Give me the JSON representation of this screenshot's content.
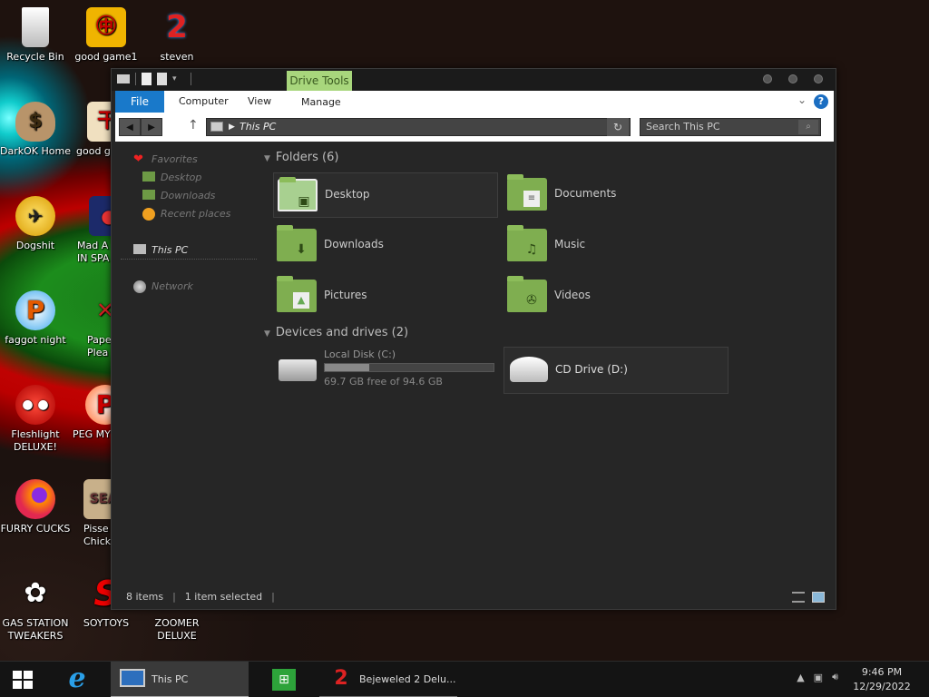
{
  "desktop": {
    "icons": [
      {
        "label": "Recycle Bin",
        "icon": "recycle-bin-icon"
      },
      {
        "label": "good game1",
        "icon": "mahjong-tile-icon"
      },
      {
        "label": "steven",
        "icon": "bejeweled-2-icon"
      },
      {
        "label": "DarkOK Home",
        "icon": "money-bag-icon"
      },
      {
        "label": "good g",
        "icon": "mahjong-tile-icon"
      },
      {
        "label": "Dogshit",
        "icon": "moorhuhn-icon"
      },
      {
        "label": "Mad A\nIN SPA",
        "icon": "angry-birds-space-icon"
      },
      {
        "label": "faggot night",
        "icon": "peggle-icon"
      },
      {
        "label": "Pape\nPlea",
        "icon": "paper-icon"
      },
      {
        "label": "Fleshlight DELUXE!",
        "icon": "red-fuzzy-creature-icon"
      },
      {
        "label": "PEG MY",
        "icon": "peggle-icon"
      },
      {
        "label": "FURRY CUCKS",
        "icon": "firefox-icon"
      },
      {
        "label": "Pisse\nChicke",
        "icon": "chicken-game-icon"
      },
      {
        "label": "GAS STATION TWEAKERS",
        "icon": "flower-pot-icon"
      },
      {
        "label": "SOYTOYS",
        "icon": "red-s-icon"
      },
      {
        "label": "ZOOMER DELUXE",
        "icon": "zuma-icon"
      }
    ]
  },
  "window": {
    "title_context_tab": "Drive Tools",
    "ribbon_tabs": {
      "file": "File",
      "computer": "Computer",
      "view": "View",
      "manage": "Manage"
    },
    "address": "This PC",
    "search_placeholder": "Search This PC",
    "nav": {
      "favorites": "Favorites",
      "desktop": "Desktop",
      "downloads": "Downloads",
      "recent": "Recent places",
      "this_pc": "This PC",
      "network": "Network"
    },
    "folders_header": "Folders (6)",
    "folders": {
      "desktop": "Desktop",
      "documents": "Documents",
      "downloads": "Downloads",
      "music": "Music",
      "pictures": "Pictures",
      "videos": "Videos"
    },
    "devices_header": "Devices and drives (2)",
    "local_disk": {
      "name": "Local Disk (C:)",
      "free": "69.7 GB free of 94.6 GB",
      "used_fraction": 0.263
    },
    "cd_drive": "CD Drive (D:)",
    "status_items": "8 items",
    "status_selected": "1 item selected"
  },
  "taskbar": {
    "this_pc": "This PC",
    "bejeweled": "Bejeweled 2 Delu...",
    "time": "9:46 PM",
    "date": "12/29/2022"
  },
  "colors": {
    "accent": "#1979ca",
    "folder_green": "#7fae50",
    "drive_tools": "#a8d67c"
  }
}
